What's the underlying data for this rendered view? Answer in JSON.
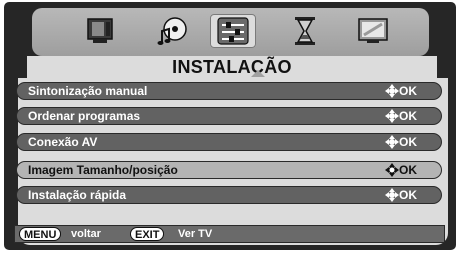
{
  "menu": {
    "title": "INSTALAÇÃO",
    "items": [
      {
        "label": "Sintonização manual",
        "ok": "OK"
      },
      {
        "label": "Ordenar programas",
        "ok": "OK"
      },
      {
        "label": "Conexão AV",
        "ok": "OK"
      },
      {
        "label": "Imagem Tamanho/posição",
        "ok": "OK"
      },
      {
        "label": "Instalação rápida",
        "ok": "OK"
      }
    ],
    "selected_index": 3
  },
  "tabs": [
    {
      "icon": "tv-icon"
    },
    {
      "icon": "sound-icon"
    },
    {
      "icon": "installation-icon",
      "active": true
    },
    {
      "icon": "timer-icon"
    },
    {
      "icon": "screen-icon"
    }
  ],
  "footer": {
    "menu_key": "MENU",
    "menu_text": "voltar",
    "exit_key": "EXIT",
    "exit_text": "Ver TV"
  }
}
